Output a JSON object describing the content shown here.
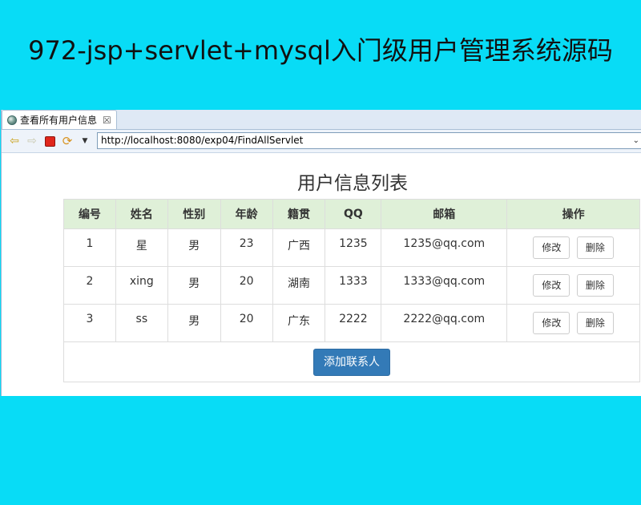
{
  "banner": {
    "title": "972-jsp+servlet+mysql入门级用户管理系统源码"
  },
  "browser": {
    "tab": {
      "title": "查看所有用户信息",
      "close_glyph": "☒"
    },
    "url": "http://localhost:8080/exp04/FindAllServlet"
  },
  "page": {
    "heading": "用户信息列表",
    "columns": [
      "编号",
      "姓名",
      "性别",
      "年龄",
      "籍贯",
      "QQ",
      "邮箱",
      "操作"
    ],
    "rows": [
      {
        "id": "1",
        "name": "星",
        "gender": "男",
        "age": "23",
        "hometown": "广西",
        "qq": "1235",
        "email": "1235@qq.com"
      },
      {
        "id": "2",
        "name": "xing",
        "gender": "男",
        "age": "20",
        "hometown": "湖南",
        "qq": "1333",
        "email": "1333@qq.com"
      },
      {
        "id": "3",
        "name": "ss",
        "gender": "男",
        "age": "20",
        "hometown": "广东",
        "qq": "2222",
        "email": "2222@qq.com"
      }
    ],
    "edit_label": "修改",
    "delete_label": "删除",
    "add_label": "添加联系人"
  },
  "colors": {
    "background": "#08dcf6",
    "table_header": "#dff0d8",
    "primary_button": "#337ab7"
  }
}
